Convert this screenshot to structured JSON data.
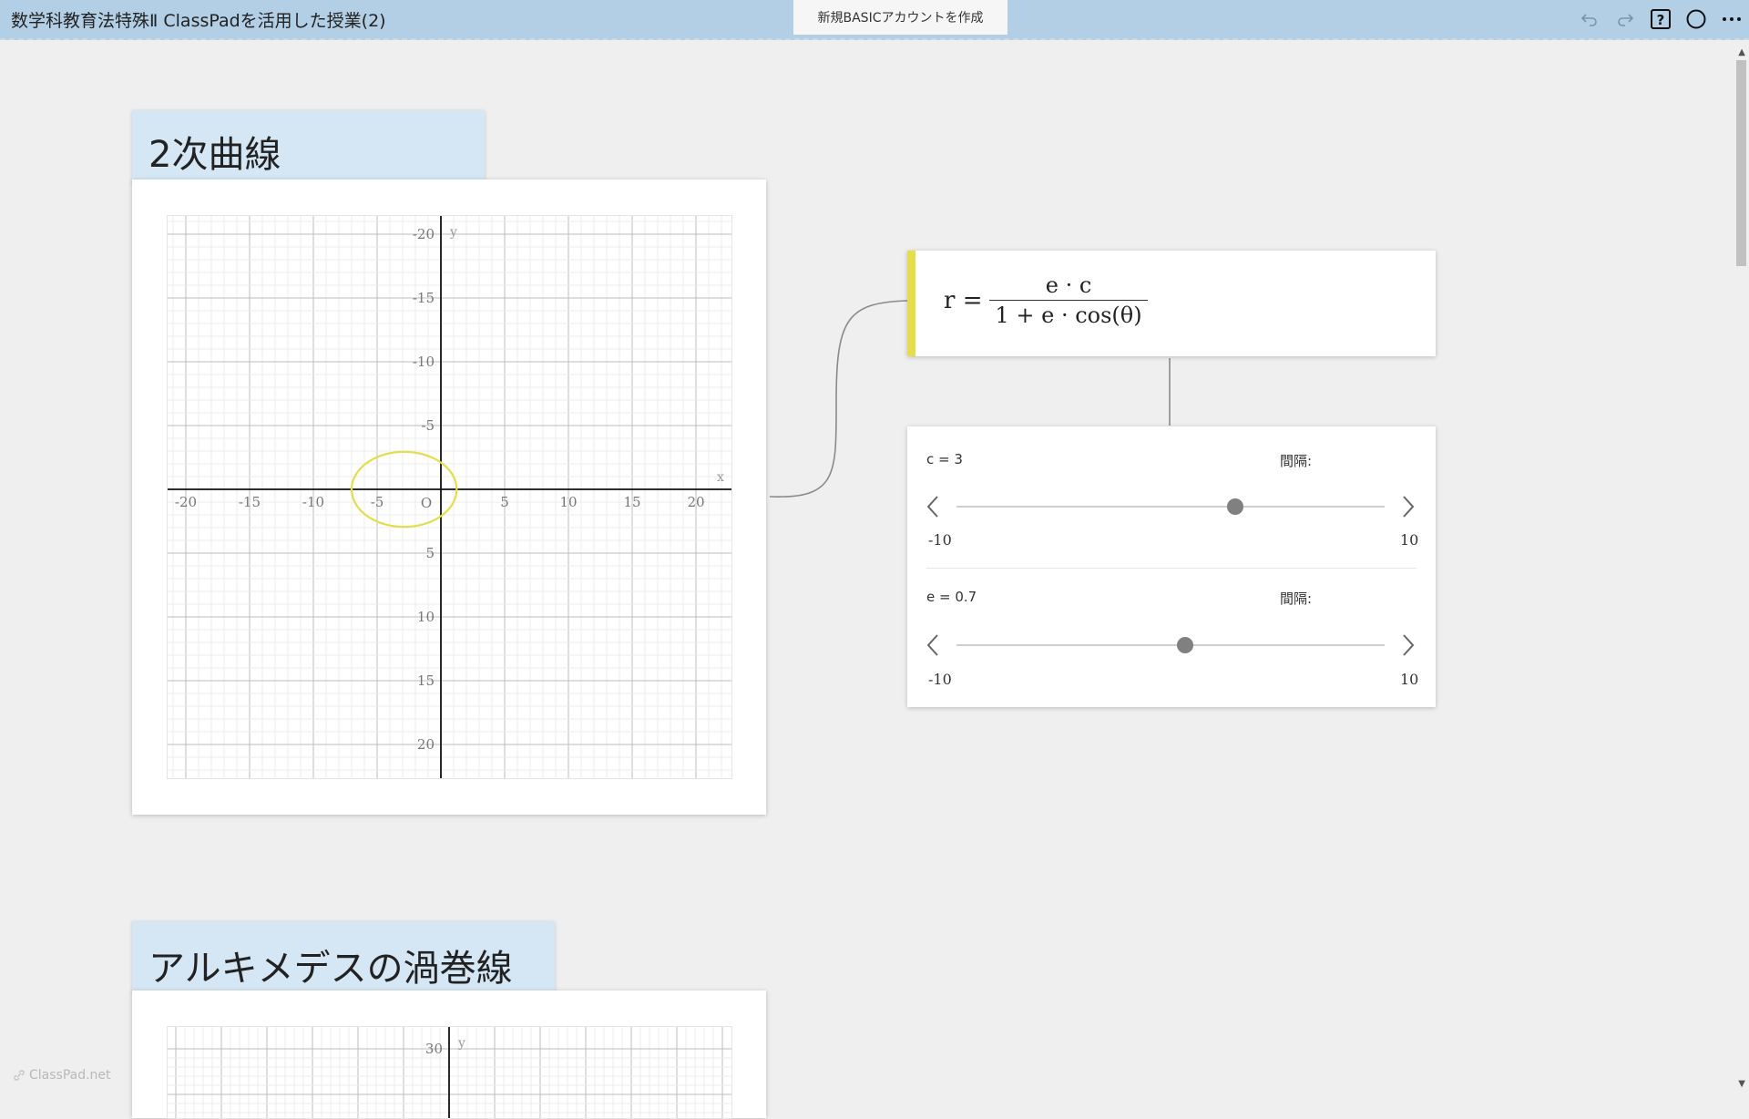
{
  "app": {
    "doc_title": "数学科教育法特殊Ⅱ ClassPadを活用した授業(2)",
    "create_account": "新規BASICアカウントを作成",
    "watermark": "ClassPad.net"
  },
  "toolbar": {
    "icons": [
      "undo-icon",
      "redo-icon",
      "help-icon",
      "circle-icon",
      "more-icon"
    ]
  },
  "sections": [
    {
      "title": "2次曲線",
      "graph": {
        "x_axis_label": "x",
        "y_axis_label": "y",
        "origin_label": "O",
        "x_ticks": [
          "-20",
          "-15",
          "-10",
          "-5",
          "5",
          "10",
          "15",
          "20"
        ],
        "y_ticks": [
          "20",
          "15",
          "10",
          "5",
          "-5",
          "-10",
          "-15",
          "-20"
        ],
        "curve_color": "#e3de4a"
      }
    },
    {
      "title": "アルキメデスの渦巻線",
      "graph": {
        "y_axis_label": "y",
        "y_ticks": [
          "30"
        ]
      }
    }
  ],
  "formula": {
    "lhs": "r =",
    "numerator": "e · c",
    "denominator": "1 + e · cos(θ)",
    "accent_color": "#e3de4a"
  },
  "sliders": [
    {
      "label": "c = 3",
      "interval_label": "間隔:",
      "min": "-10",
      "max": "10",
      "value": 3
    },
    {
      "label": "e = 0.7",
      "interval_label": "間隔:",
      "min": "-10",
      "max": "10",
      "value": 0.7
    }
  ],
  "chart_data": {
    "type": "scatter",
    "title": "",
    "xlabel": "x",
    "ylabel": "y",
    "xlim": [
      -22,
      22
    ],
    "ylim": [
      -22,
      22
    ],
    "xticks": [
      -20,
      -15,
      -10,
      -5,
      5,
      10,
      15,
      20
    ],
    "yticks": [
      -20,
      -15,
      -10,
      -5,
      5,
      10,
      15,
      20
    ],
    "grid": true,
    "series": [
      {
        "equation": "r = e·c / (1 + e·cos(θ))",
        "params": {
          "c": 3,
          "e": 0.7
        }
      }
    ]
  }
}
